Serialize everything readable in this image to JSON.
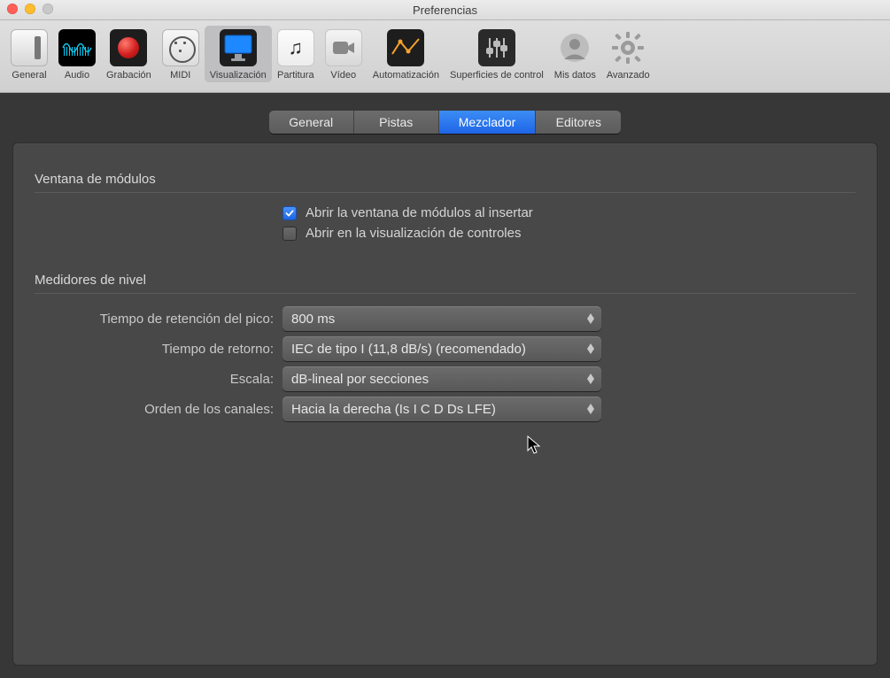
{
  "window": {
    "title": "Preferencias"
  },
  "toolbar": {
    "items": [
      {
        "id": "general",
        "label": "General"
      },
      {
        "id": "audio",
        "label": "Audio"
      },
      {
        "id": "grabacion",
        "label": "Grabación"
      },
      {
        "id": "midi",
        "label": "MIDI"
      },
      {
        "id": "visualizacion",
        "label": "Visualización"
      },
      {
        "id": "partitura",
        "label": "Partitura"
      },
      {
        "id": "video",
        "label": "Vídeo"
      },
      {
        "id": "automatizacion",
        "label": "Automatización"
      },
      {
        "id": "superficies",
        "label": "Superficies de control"
      },
      {
        "id": "misdatos",
        "label": "Mis datos"
      },
      {
        "id": "avanzado",
        "label": "Avanzado"
      }
    ],
    "selected": "visualizacion"
  },
  "subtabs": {
    "items": [
      {
        "label": "General"
      },
      {
        "label": "Pistas"
      },
      {
        "label": "Mezclador"
      },
      {
        "label": "Editores"
      }
    ],
    "selected_index": 2
  },
  "sections": {
    "modules": {
      "title": "Ventana de módulos",
      "chk_open_on_insert": {
        "label": "Abrir la ventana de módulos al insertar",
        "checked": true
      },
      "chk_open_controls": {
        "label": "Abrir en la visualización de controles",
        "checked": false
      }
    },
    "meters": {
      "title": "Medidores de nivel",
      "peak_hold": {
        "label": "Tiempo de retención del pico:",
        "value": "800 ms"
      },
      "return_time": {
        "label": "Tiempo de retorno:",
        "value": "IEC de tipo I (11,8 dB/s) (recomendado)"
      },
      "scale": {
        "label": "Escala:",
        "value": "dB-lineal por secciones"
      },
      "chan_order": {
        "label": "Orden de los canales:",
        "value": "Hacia la derecha (Is I C D Ds LFE)"
      }
    }
  }
}
